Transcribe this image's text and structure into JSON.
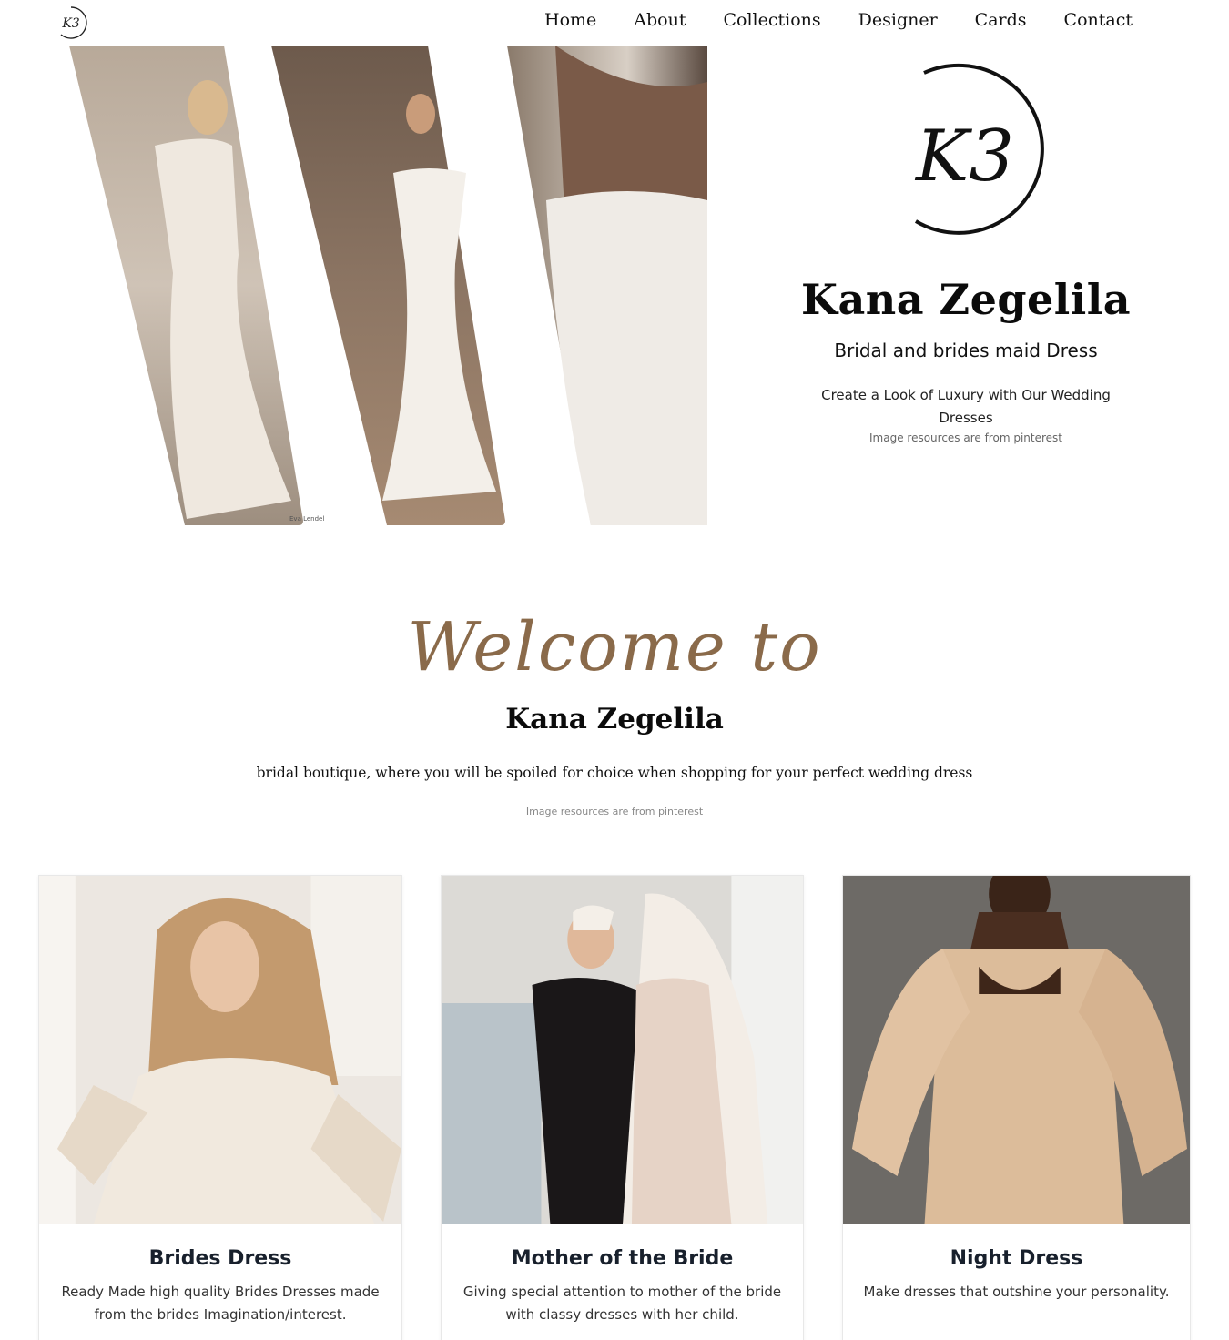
{
  "nav": {
    "logo_monogram": "K3",
    "links": [
      "Home",
      "About",
      "Collections",
      "Designer",
      "Cards",
      "Contact"
    ]
  },
  "hero": {
    "logo_monogram": "K3",
    "title": "Kana Zegelila",
    "subtitle": "Bridal and brides maid Dress",
    "description": "Create a Look of Luxury with Our Wedding Dresses",
    "credit": "Image resources are from pinterest",
    "photo_caption": "Eva Lendel"
  },
  "welcome": {
    "script": "Welcome to",
    "name": "Kana Zegelila",
    "tagline": "bridal boutique, where you will be spoiled for choice when shopping for your perfect wedding dress",
    "credit": "Image resources are from pinterest"
  },
  "cards": [
    {
      "title": "Brides Dress",
      "text": "Ready Made high quality Brides Dresses made from the brides Imagination/interest."
    },
    {
      "title": "Mother of the Bride",
      "text": "Giving special attention to mother of the bride with classy dresses with her child."
    },
    {
      "title": "Night Dress",
      "text": "Make dresses that outshine your personality."
    }
  ],
  "colors": {
    "accent_red": "#e53935",
    "script_brown": "#8a6a4a",
    "text_dark": "#0b0b0b"
  }
}
